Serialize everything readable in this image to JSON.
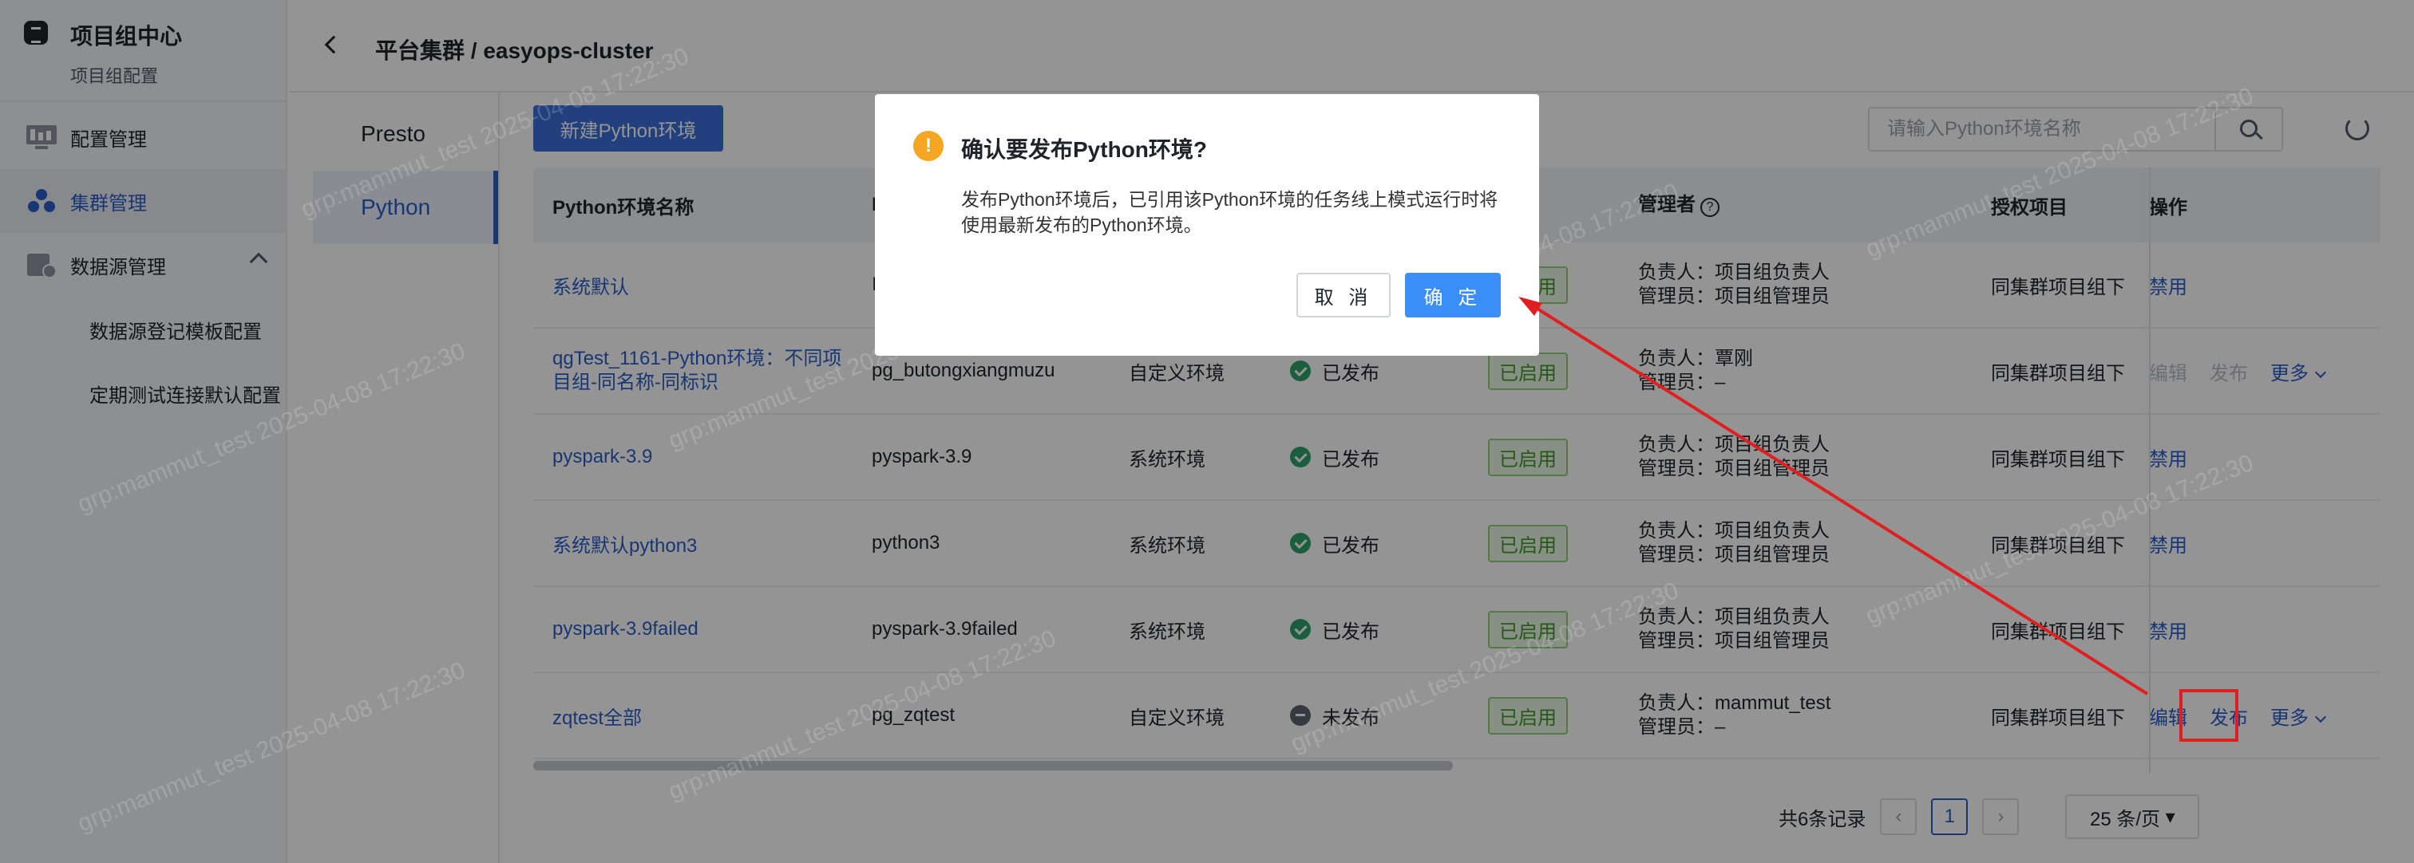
{
  "sidebar": {
    "brand_title": "项目组中心",
    "brand_sub": "项目组配置",
    "items": [
      {
        "label": "配置管理",
        "icon": "monitor-icon"
      },
      {
        "label": "集群管理",
        "icon": "cluster-icon"
      },
      {
        "label": "数据源管理",
        "icon": "datasource-icon"
      }
    ],
    "subitems": [
      "数据源登记模板配置",
      "定期测试连接默认配置"
    ]
  },
  "header": {
    "breadcrumb": "平台集群 / easyops-cluster"
  },
  "subnav": [
    "Presto",
    "Python"
  ],
  "toolbar": {
    "new_label": "新建Python环境",
    "search_placeholder": "请输入Python环境名称"
  },
  "table": {
    "headers": {
      "name": "Python环境名称",
      "id": "I",
      "owner": "管理者",
      "auth": "授权项目",
      "ops": "操作"
    },
    "rows": [
      {
        "name": "系统默认",
        "id": "I",
        "type": "",
        "status": "",
        "enabled": "已启用",
        "owner1": "负责人：项目组负责人",
        "owner2": "管理员：项目组管理员",
        "auth": "同集群项目组下",
        "ops": [
          "禁用"
        ]
      },
      {
        "name": "qgTest_1161-Python环境：不同项目组-同名称-同标识",
        "id": "pg_butongxiangmuzu",
        "type": "自定义环境",
        "status": "已发布",
        "enabled": "已启用",
        "owner1": "负责人：覃刚",
        "owner2": "管理员：–",
        "auth": "同集群项目组下",
        "ops": [
          "编辑",
          "发布",
          "更多"
        ]
      },
      {
        "name": "pyspark-3.9",
        "id": "pyspark-3.9",
        "type": "系统环境",
        "status": "已发布",
        "enabled": "已启用",
        "owner1": "负责人：项目组负责人",
        "owner2": "管理员：项目组管理员",
        "auth": "同集群项目组下",
        "ops": [
          "禁用"
        ]
      },
      {
        "name": "系统默认python3",
        "id": "python3",
        "type": "系统环境",
        "status": "已发布",
        "enabled": "已启用",
        "owner1": "负责人：项目组负责人",
        "owner2": "管理员：项目组管理员",
        "auth": "同集群项目组下",
        "ops": [
          "禁用"
        ]
      },
      {
        "name": "pyspark-3.9failed",
        "id": "pyspark-3.9failed",
        "type": "系统环境",
        "status": "已发布",
        "enabled": "已启用",
        "owner1": "负责人：项目组负责人",
        "owner2": "管理员：项目组管理员",
        "auth": "同集群项目组下",
        "ops": [
          "禁用"
        ]
      },
      {
        "name": "zqtest全部",
        "id": "pg_zqtest",
        "type": "自定义环境",
        "status": "未发布",
        "enabled": "已启用",
        "owner1": "负责人：mammut_test",
        "owner2": "管理员：–",
        "auth": "同集群项目组下",
        "ops": [
          "编辑",
          "发布",
          "更多"
        ]
      }
    ]
  },
  "pager": {
    "total": "共6条记录",
    "current": "1",
    "size": "25 条/页"
  },
  "modal": {
    "title": "确认要发布Python环境?",
    "body": "发布Python环境后，已引用该Python环境的任务线上模式运行时将使用最新发布的Python环境。",
    "cancel": "取 消",
    "ok": "确 定"
  },
  "watermark": "grp:mammut_test 2025-04-08 17:22:30",
  "colors": {
    "accent": "#2a5dc8",
    "primary_button": "#3b8ef7",
    "annotation": "#e02020"
  }
}
